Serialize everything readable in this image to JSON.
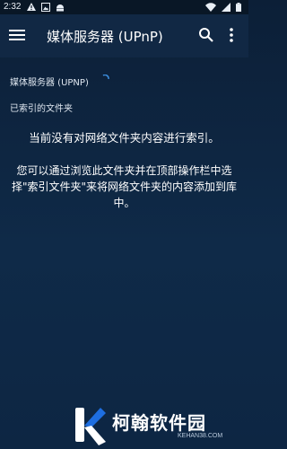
{
  "status_bar": {
    "time": "2:32",
    "left_icons": [
      "warning-icon",
      "image-icon",
      "android-icon"
    ],
    "right_icons": [
      "wifi-icon",
      "signal-icon",
      "battery-icon"
    ]
  },
  "app_bar": {
    "title": "媒体服务器 (UPnP)",
    "menu_icon": "menu-icon",
    "search_icon": "search-icon",
    "more_icon": "more-vert-icon"
  },
  "content": {
    "server_label": "媒体服务器 (UPNP)",
    "section_label": "已索引的文件夹",
    "empty_message": "当前没有对网络文件夹内容进行索引。",
    "hint_message": "您可以通过浏览此文件夹并在顶部操作栏中选择\"索引文件夹\"来将网络文件夹的内容添加到库中。"
  },
  "watermark": {
    "text": "柯翰软件园",
    "sub": "KEHAN38.COM"
  },
  "colors": {
    "app_bar": "#112844",
    "background": "#0f2a48",
    "status_bar": "#091726",
    "spinner": "#3d8fe0"
  }
}
